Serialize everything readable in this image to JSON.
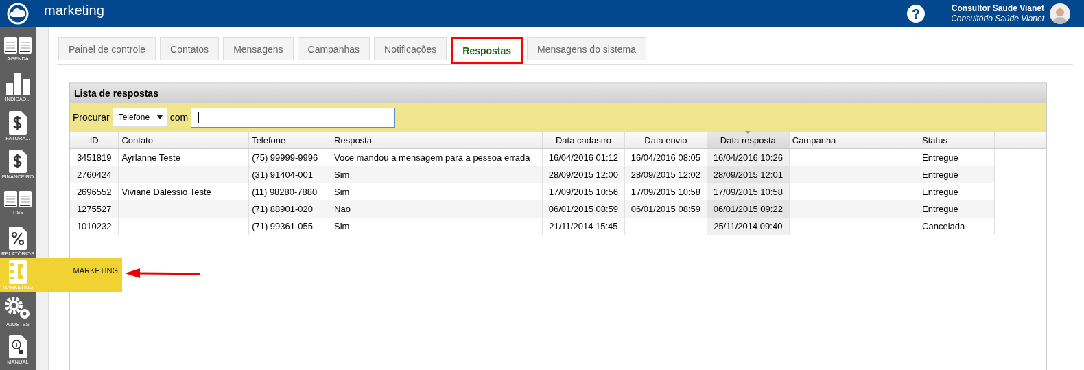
{
  "header": {
    "title": "marketing",
    "help": "?",
    "user_name": "Consultor Saude Vianet",
    "clinic": "Consultório Saúde Vianet"
  },
  "sidebar": {
    "items": [
      {
        "label": "AGENDA",
        "selected": false,
        "highlighted": false
      },
      {
        "label": "INDICAD...",
        "selected": false,
        "highlighted": false
      },
      {
        "label": "FATURA...",
        "selected": false,
        "highlighted": false
      },
      {
        "label": "FINANCEIRO",
        "selected": false,
        "highlighted": false
      },
      {
        "label": "TISS",
        "selected": false,
        "highlighted": false
      },
      {
        "label": "RELATÓRIOS",
        "selected": false,
        "highlighted": false
      },
      {
        "label": "MARKETING",
        "selected": true,
        "flyout": "MARKETING",
        "highlighted": true
      },
      {
        "label": "AJUSTES",
        "selected": false,
        "highlighted": false
      },
      {
        "label": "MANUAL",
        "selected": false,
        "highlighted": false
      }
    ]
  },
  "tabs": [
    {
      "label": "Painel de controle",
      "selected": false,
      "highlighted": false
    },
    {
      "label": "Contatos",
      "selected": false,
      "highlighted": false
    },
    {
      "label": "Mensagens",
      "selected": false,
      "highlighted": false
    },
    {
      "label": "Campanhas",
      "selected": false,
      "highlighted": false
    },
    {
      "label": "Notificações",
      "selected": false,
      "highlighted": false
    },
    {
      "label": "Respostas",
      "selected": true,
      "highlighted": true
    },
    {
      "label": "Mensagens do sistema",
      "selected": false,
      "highlighted": false
    }
  ],
  "panel": {
    "title": "Lista de respostas",
    "search_label": "Procurar",
    "search_field": "Telefone",
    "search_joiner": "com"
  },
  "table": {
    "columns": [
      {
        "label": "ID",
        "sorted": false
      },
      {
        "label": "Contato",
        "sorted": false
      },
      {
        "label": "Telefone",
        "sorted": false
      },
      {
        "label": "Resposta",
        "sorted": false
      },
      {
        "label": "Data cadastro",
        "sorted": false
      },
      {
        "label": "Data envio",
        "sorted": false
      },
      {
        "label": "Data resposta",
        "sorted": true
      },
      {
        "label": "Campanha",
        "sorted": false
      },
      {
        "label": "Status",
        "sorted": false
      }
    ],
    "rows": [
      [
        "3451819",
        "Ayrlanne Teste",
        "(75) 99999-9996",
        "Voce mandou a mensagem para a pessoa errada",
        "16/04/2016 01:12",
        "16/04/2016 08:05",
        "16/04/2016 10:26",
        "",
        "Entregue"
      ],
      [
        "2760424",
        "",
        "(31) 91404-001",
        "Sim",
        "28/09/2015 12:00",
        "28/09/2015 12:02",
        "28/09/2015 12:01",
        "",
        "Entregue"
      ],
      [
        "2696552",
        "Viviane Dalessio Teste",
        "(11) 98280-7880",
        "Sim",
        "17/09/2015 10:56",
        "17/09/2015 10:58",
        "17/09/2015 10:58",
        "",
        "Entregue"
      ],
      [
        "1275527",
        "",
        "(71) 88901-020",
        "Nao",
        "06/01/2015 08:59",
        "06/01/2015 08:59",
        "06/01/2015 09:22",
        "",
        "Entregue"
      ],
      [
        "1010232",
        "",
        "(71) 99361-055",
        "Sim",
        "21/11/2014 15:45",
        "",
        "25/11/2014 09:40",
        "",
        "Cancelada"
      ]
    ]
  }
}
